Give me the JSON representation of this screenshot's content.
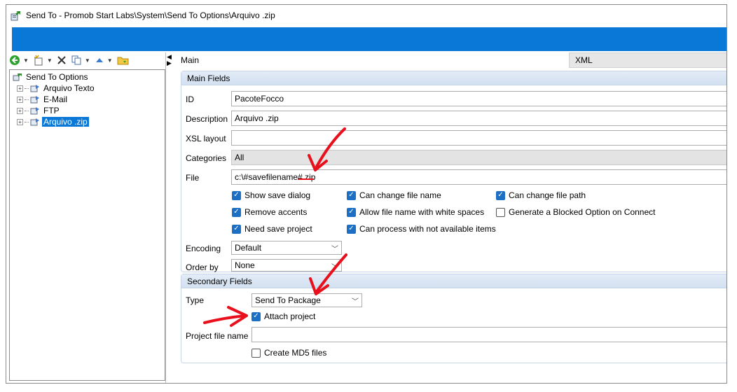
{
  "window": {
    "title": "Send To - Promob Start Labs\\System\\Send To Options\\Arquivo .zip"
  },
  "tree": {
    "root": "Send To Options",
    "items": [
      {
        "label": "Arquivo Texto",
        "selected": false
      },
      {
        "label": "E-Mail",
        "selected": false
      },
      {
        "label": "FTP",
        "selected": false
      },
      {
        "label": "Arquivo .zip",
        "selected": true
      }
    ]
  },
  "tabs": {
    "main": "Main",
    "xml": "XML"
  },
  "main_fields": {
    "header": "Main Fields",
    "id_label": "ID",
    "id_value": "PacoteFocco",
    "description_label": "Description",
    "description_value": "Arquivo .zip",
    "xsl_label": "XSL layout",
    "xsl_value": "",
    "categories_label": "Categories",
    "categories_value": "All",
    "file_label": "File",
    "file_value": "c:\\#savefilename#.zip",
    "checkboxes": [
      {
        "label": "Show save dialog",
        "checked": true
      },
      {
        "label": "Can change file name",
        "checked": true
      },
      {
        "label": "Can change file path",
        "checked": true
      },
      {
        "label": "Remove accents",
        "checked": true
      },
      {
        "label": "Allow file name with white spaces",
        "checked": true
      },
      {
        "label": "Generate a Blocked Option on Connect",
        "checked": false
      },
      {
        "label": "Need save project",
        "checked": true
      },
      {
        "label": "Can process with not available items",
        "checked": true
      }
    ],
    "encoding_label": "Encoding",
    "encoding_value": "Default",
    "orderby_label": "Order by",
    "orderby_value": "None"
  },
  "secondary_fields": {
    "header": "Secondary Fields",
    "type_label": "Type",
    "type_value": "Send To Package",
    "attach_label": "Attach project",
    "attach_checked": true,
    "project_file_label": "Project file name",
    "project_file_value": "",
    "md5_label": "Create MD5 files",
    "md5_checked": false
  },
  "colors": {
    "accent": "#0a78d7",
    "checkbox": "#1d6fc4",
    "annotation": "#e8101c"
  }
}
